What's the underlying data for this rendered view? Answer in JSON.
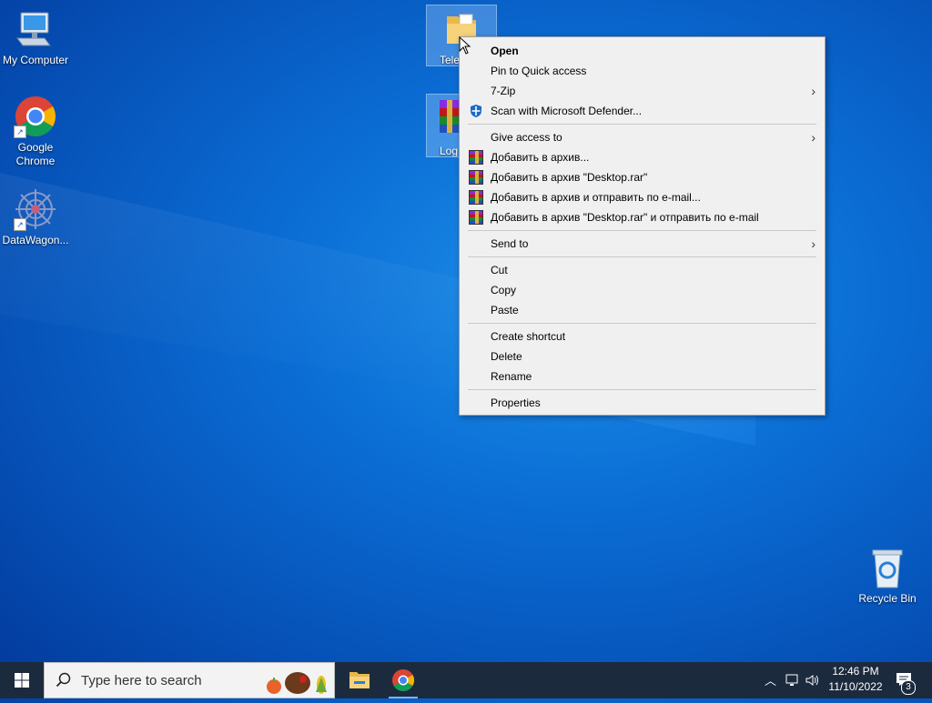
{
  "desktop": {
    "icons": [
      {
        "label": "My Computer"
      },
      {
        "label": "Google Chrome"
      },
      {
        "label": "DataWagon..."
      },
      {
        "label": "Tele"
      },
      {
        "label": "Log"
      },
      {
        "label": "Recycle Bin"
      }
    ]
  },
  "context_menu": {
    "items": [
      {
        "label": "Open"
      },
      {
        "label": "Pin to Quick access"
      },
      {
        "label": "7-Zip"
      },
      {
        "label": "Scan with Microsoft Defender..."
      },
      {
        "label": "Give access to"
      },
      {
        "label": "Добавить в архив..."
      },
      {
        "label": "Добавить в архив \"Desktop.rar\""
      },
      {
        "label": "Добавить в архив и отправить по e-mail..."
      },
      {
        "label": "Добавить в архив \"Desktop.rar\" и отправить по e-mail"
      },
      {
        "label": "Send to"
      },
      {
        "label": "Cut"
      },
      {
        "label": "Copy"
      },
      {
        "label": "Paste"
      },
      {
        "label": "Create shortcut"
      },
      {
        "label": "Delete"
      },
      {
        "label": "Rename"
      },
      {
        "label": "Properties"
      }
    ]
  },
  "taskbar": {
    "search_placeholder": "Type here to search",
    "clock_time": "12:46 PM",
    "clock_date": "11/10/2022",
    "notification_count": "3"
  },
  "colors": {
    "desktop_blue": "#0b6fd6",
    "taskbar": "#1c2a3d",
    "menu_bg": "#f0f0f0"
  }
}
